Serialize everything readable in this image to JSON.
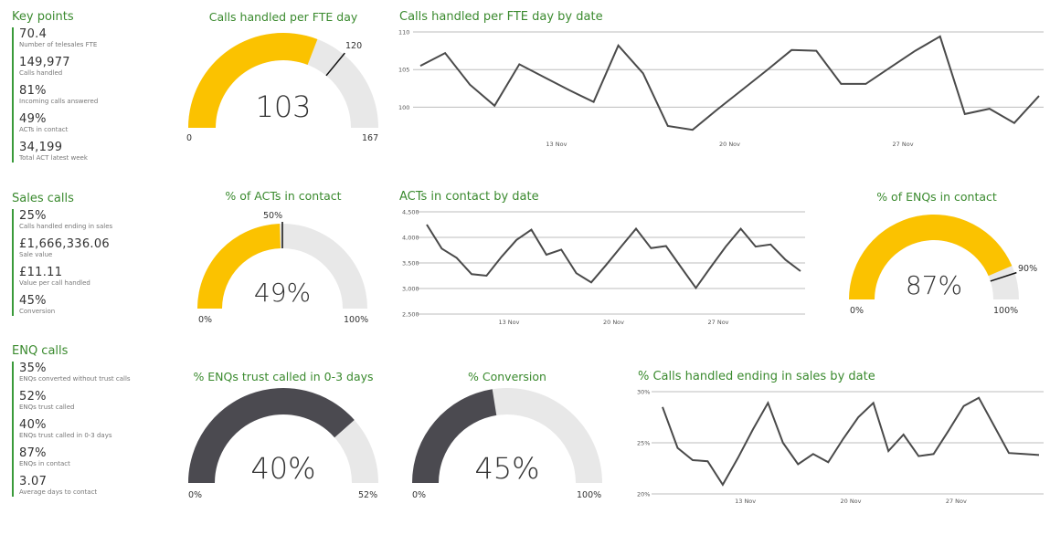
{
  "colors": {
    "accent_green": "#3a8a2e",
    "gauge_yellow": "#fbc200",
    "gauge_dark": "#4b4a50",
    "gauge_track": "#e8e8e8",
    "line": "#4a4a4a"
  },
  "key_points": {
    "title": "Key points",
    "items": [
      {
        "value": "70.4",
        "label": "Number of telesales FTE"
      },
      {
        "value": "149,977",
        "label": "Calls handled"
      },
      {
        "value": "81%",
        "label": "Incoming calls answered"
      },
      {
        "value": "49%",
        "label": "ACTs in contact"
      },
      {
        "value": "34,199",
        "label": "Total ACT latest week"
      }
    ]
  },
  "sales_calls": {
    "title": "Sales calls",
    "items": [
      {
        "value": "25%",
        "label": "Calls handled ending in sales"
      },
      {
        "value": "£1,666,336.06",
        "label": "Sale value"
      },
      {
        "value": "£11.11",
        "label": "Value per call handled"
      },
      {
        "value": "45%",
        "label": "Conversion"
      }
    ]
  },
  "enq_calls": {
    "title": "ENQ calls",
    "items": [
      {
        "value": "35%",
        "label": "ENQs converted without trust calls"
      },
      {
        "value": "52%",
        "label": "ENQs trust called"
      },
      {
        "value": "40%",
        "label": "ENQs trust called in 0-3 days"
      },
      {
        "value": "87%",
        "label": "ENQs in contact"
      },
      {
        "value": "3.07",
        "label": "Average days to contact"
      }
    ]
  },
  "gauges": {
    "calls_fte": {
      "title": "Calls handled per FTE day",
      "value": "103",
      "min": "0",
      "max": "167",
      "target": "120",
      "fill": 0.617,
      "target_frac": 0.719
    },
    "acts_contact": {
      "title": "% of ACTs in contact",
      "value": "49%",
      "min": "0%",
      "max": "100%",
      "target": "50%",
      "fill": 0.49,
      "target_frac": 0.5
    },
    "enqs_contact": {
      "title": "% of ENQs in contact",
      "value": "87%",
      "min": "0%",
      "max": "100%",
      "target": "90%",
      "fill": 0.87,
      "target_frac": 0.9
    },
    "enqs_trust": {
      "title": "% ENQs trust called in 0-3 days",
      "value": "40%",
      "min": "0%",
      "max": "52%",
      "fill": 0.769
    },
    "conversion": {
      "title": "% Conversion",
      "value": "45%",
      "min": "0%",
      "max": "100%",
      "fill": 0.45
    }
  },
  "chart_data": [
    {
      "type": "line",
      "title": "Calls handled per FTE day by date",
      "y_ticks": [
        100,
        105,
        110
      ],
      "ylim": [
        95.2,
        110
      ],
      "x_ticks": [
        "13 Nov",
        "20 Nov",
        "27 Nov"
      ],
      "tick_index": [
        5.5,
        12.5,
        19.5
      ],
      "values": [
        105.5,
        107.2,
        103.0,
        100.2,
        105.7,
        104.0,
        102.3,
        100.7,
        108.2,
        104.5,
        97.5,
        97.0,
        99.7,
        102.3,
        104.9,
        107.6,
        107.5,
        103.1,
        103.1,
        105.3,
        107.5,
        109.4,
        99.1,
        99.8,
        97.9,
        101.5
      ]
    },
    {
      "type": "line",
      "title": "ACTs in contact by date",
      "y_ticks": [
        "2,500",
        "3,000",
        "3,500",
        "4,000",
        "4,500"
      ],
      "y_tick_values": [
        2500,
        3000,
        3500,
        4000,
        4500
      ],
      "ylim": [
        2500,
        4500
      ],
      "x_ticks": [
        "13 Nov",
        "20 Nov",
        "27 Nov"
      ],
      "tick_index": [
        5.5,
        12.5,
        19.5
      ],
      "values": [
        4250,
        3780,
        3600,
        3280,
        3250,
        3620,
        3950,
        4150,
        3660,
        3760,
        3300,
        3120,
        3460,
        3820,
        4170,
        3790,
        3830,
        3420,
        3010,
        3420,
        3820,
        4170,
        3820,
        3860,
        3560,
        3340
      ]
    },
    {
      "type": "line",
      "title": "% Calls handled ending in sales by date",
      "y_ticks": [
        "20%",
        "25%",
        "30%"
      ],
      "y_tick_values": [
        20,
        25,
        30
      ],
      "ylim": [
        20,
        30
      ],
      "x_ticks": [
        "13 Nov",
        "20 Nov",
        "27 Nov"
      ],
      "tick_index": [
        5.5,
        12.5,
        19.5
      ],
      "values": [
        28.5,
        24.5,
        23.3,
        23.2,
        20.9,
        23.5,
        26.3,
        28.9,
        25.0,
        22.9,
        23.9,
        23.1,
        25.4,
        27.5,
        28.9,
        24.2,
        25.8,
        23.7,
        23.9,
        26.2,
        28.6,
        29.4,
        26.7,
        24.0,
        23.9,
        23.8
      ]
    }
  ]
}
